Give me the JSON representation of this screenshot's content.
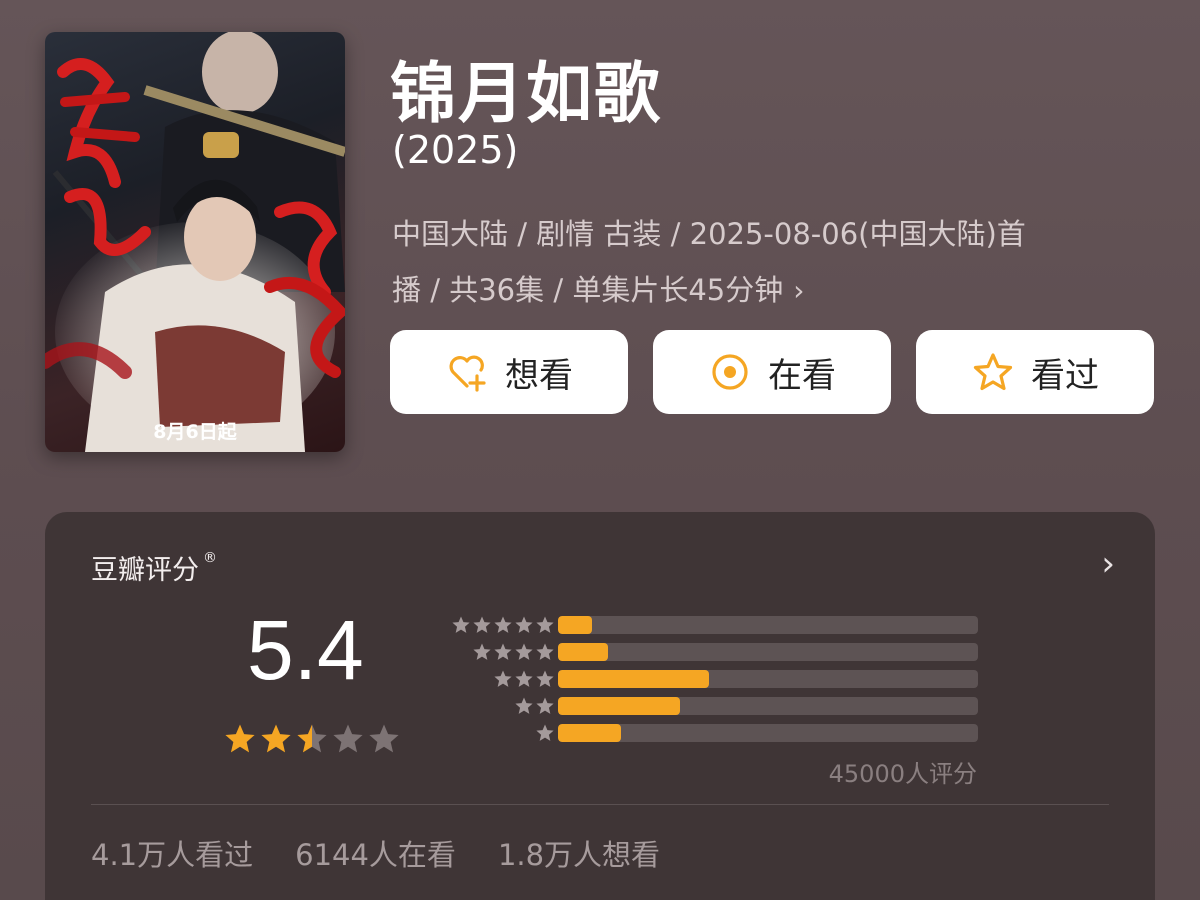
{
  "poster": {
    "date_text": "8月6日起",
    "title_art": "锦月如歌"
  },
  "title": "锦月如歌",
  "year": "(2025)",
  "meta": {
    "line1": "中国大陆 / 剧情 古装 / 2025-08-06(中国大陆)首",
    "line2": "播 / 共36集 / 单集片长45分钟",
    "chevron": "›"
  },
  "actions": {
    "want": {
      "label": "想看",
      "icon": "heart-plus-icon"
    },
    "watching": {
      "label": "在看",
      "icon": "target-icon"
    },
    "watched": {
      "label": "看过",
      "icon": "star-outline-icon"
    }
  },
  "rating": {
    "title": "豆瓣评分",
    "registered_mark": "®",
    "chevron": "›",
    "score": "5.4",
    "stars": 2.5,
    "distribution": [
      {
        "stars": 5,
        "fraction": 0.08
      },
      {
        "stars": 4,
        "fraction": 0.12
      },
      {
        "stars": 3,
        "fraction": 0.36
      },
      {
        "stars": 2,
        "fraction": 0.29
      },
      {
        "stars": 1,
        "fraction": 0.15
      }
    ],
    "count_text": "45000人评分"
  },
  "stats": {
    "watched": "4.1万人看过",
    "watching": "6144人在看",
    "want": "1.8万人想看"
  },
  "colors": {
    "accent": "#f5a623",
    "background": "#5f5052",
    "card": "#3f3536"
  }
}
